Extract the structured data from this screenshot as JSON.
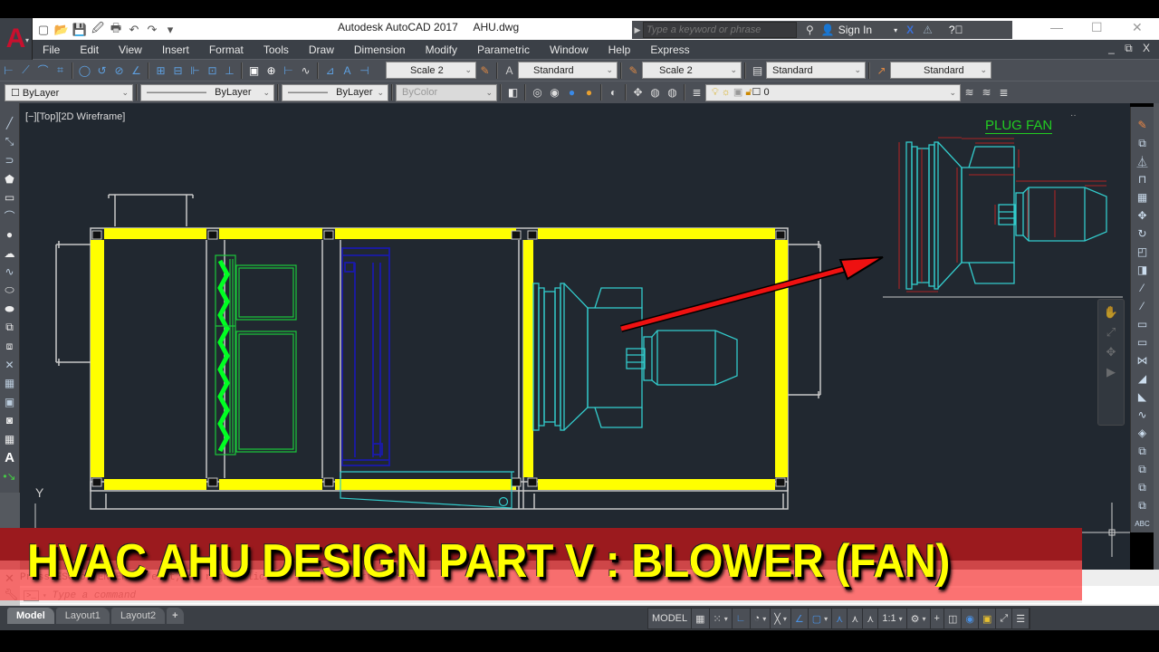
{
  "app": {
    "logo_letter": "A",
    "title": "Autodesk AutoCAD 2017",
    "filename": "AHU.dwg"
  },
  "quick_access": [
    {
      "name": "new-icon",
      "glyph": "▢"
    },
    {
      "name": "open-icon",
      "glyph": "📂"
    },
    {
      "name": "save-icon",
      "glyph": "💾"
    },
    {
      "name": "save-as-icon",
      "glyph": "🖉"
    },
    {
      "name": "plot-icon",
      "glyph": "🖶"
    },
    {
      "name": "undo-icon",
      "glyph": "↶"
    },
    {
      "name": "redo-icon",
      "glyph": "↷"
    },
    {
      "name": "customize-icon",
      "glyph": "▾"
    }
  ],
  "search": {
    "placeholder": "Type a keyword or phrase",
    "sign_in": "Sign In"
  },
  "window_controls": {
    "minimize": "—",
    "maximize": "☐",
    "close": "✕"
  },
  "menu": [
    "File",
    "Edit",
    "View",
    "Insert",
    "Format",
    "Tools",
    "Draw",
    "Dimension",
    "Modify",
    "Parametric",
    "Window",
    "Help",
    "Express"
  ],
  "menu_right_controls": "_ ⧉ X",
  "toolbar1": {
    "dim_scale": "Scale 2",
    "text_style": "Standard",
    "annot_scale": "Scale 2",
    "table_style": "Standard",
    "multileader_style": "Standard"
  },
  "toolbar2": {
    "color": "ByLayer",
    "linetype": "ByLayer",
    "lineweight": "ByLayer",
    "plot_style": "ByColor",
    "layer": "0"
  },
  "viewport": {
    "label": "[−][Top][2D Wireframe]",
    "annotation_title": "PLUG FAN",
    "ucs_y": "Y",
    "colors": {
      "background": "#212830",
      "casing": "#ffff00",
      "frame": "#c8c8c8",
      "filter": "#00ff22",
      "coil": "#1a1aaa",
      "fan": "#33cccc",
      "dimension": "#dd2222",
      "arrow": "#ee1111",
      "title": "#22cc22"
    }
  },
  "command": {
    "history": "Press ESC or ENTER to exit, or right-click to display shortcut menu.",
    "placeholder": "Type a command",
    "prompt": ">_"
  },
  "banner": {
    "text": "HVAC AHU DESIGN PART V : BLOWER (FAN)"
  },
  "layout_tabs": [
    {
      "label": "Model",
      "active": true
    },
    {
      "label": "Layout1",
      "active": false
    },
    {
      "label": "Layout2",
      "active": false
    },
    {
      "label": "+",
      "active": false
    }
  ],
  "status_bar": {
    "model": "MODEL",
    "scale": "1:1"
  }
}
